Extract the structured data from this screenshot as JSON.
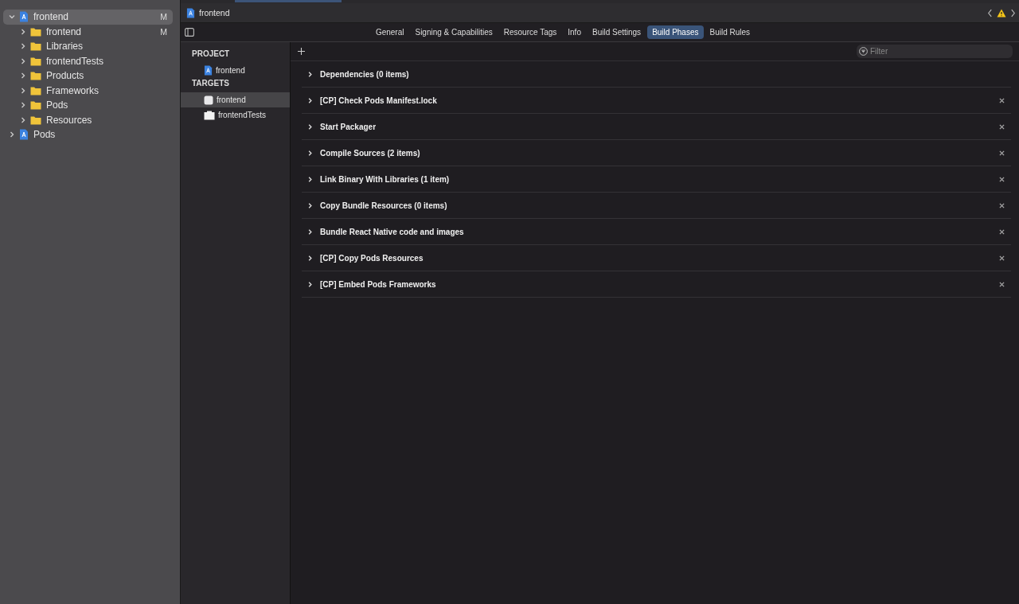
{
  "navigator": {
    "items": [
      {
        "label": "frontend",
        "kind": "project",
        "badge": "M",
        "expanded": true,
        "selected": true,
        "children": [
          {
            "label": "frontend",
            "kind": "folder",
            "badge": "M",
            "expanded": false,
            "selected": false
          },
          {
            "label": "Libraries",
            "kind": "folder",
            "expanded": false,
            "selected": false
          },
          {
            "label": "frontendTests",
            "kind": "folder",
            "expanded": false,
            "selected": false
          },
          {
            "label": "Products",
            "kind": "folder",
            "expanded": false,
            "selected": false
          },
          {
            "label": "Frameworks",
            "kind": "folder",
            "expanded": false,
            "selected": false
          },
          {
            "label": "Pods",
            "kind": "folder",
            "expanded": false,
            "selected": false
          },
          {
            "label": "Resources",
            "kind": "folder",
            "expanded": false,
            "selected": false
          }
        ]
      },
      {
        "label": "Pods",
        "kind": "project",
        "expanded": false,
        "selected": false
      }
    ]
  },
  "jump_bar": {
    "title": "frontend"
  },
  "tabs": [
    {
      "label": "General",
      "selected": false
    },
    {
      "label": "Signing & Capabilities",
      "selected": false
    },
    {
      "label": "Resource Tags",
      "selected": false
    },
    {
      "label": "Info",
      "selected": false
    },
    {
      "label": "Build Settings",
      "selected": false
    },
    {
      "label": "Build Phases",
      "selected": true
    },
    {
      "label": "Build Rules",
      "selected": false
    }
  ],
  "targets_list": {
    "sections": [
      {
        "heading": "PROJECT",
        "items": [
          {
            "label": "frontend",
            "kind": "project",
            "selected": false
          }
        ]
      },
      {
        "heading": "TARGETS",
        "items": [
          {
            "label": "frontend",
            "kind": "app",
            "selected": true
          },
          {
            "label": "frontendTests",
            "kind": "tests",
            "selected": false
          }
        ]
      }
    ]
  },
  "filter": {
    "placeholder": "Filter"
  },
  "phases": [
    {
      "title": "Dependencies (0 items)",
      "removable": false
    },
    {
      "title": "[CP] Check Pods Manifest.lock",
      "removable": true
    },
    {
      "title": "Start Packager",
      "removable": true
    },
    {
      "title": "Compile Sources (2 items)",
      "removable": true
    },
    {
      "title": "Link Binary With Libraries (1 item)",
      "removable": true
    },
    {
      "title": "Copy Bundle Resources (0 items)",
      "removable": true
    },
    {
      "title": "Bundle React Native code and images",
      "removable": true
    },
    {
      "title": "[CP] Copy Pods Resources",
      "removable": true
    },
    {
      "title": "[CP] Embed Pods Frameworks",
      "removable": true
    }
  ]
}
